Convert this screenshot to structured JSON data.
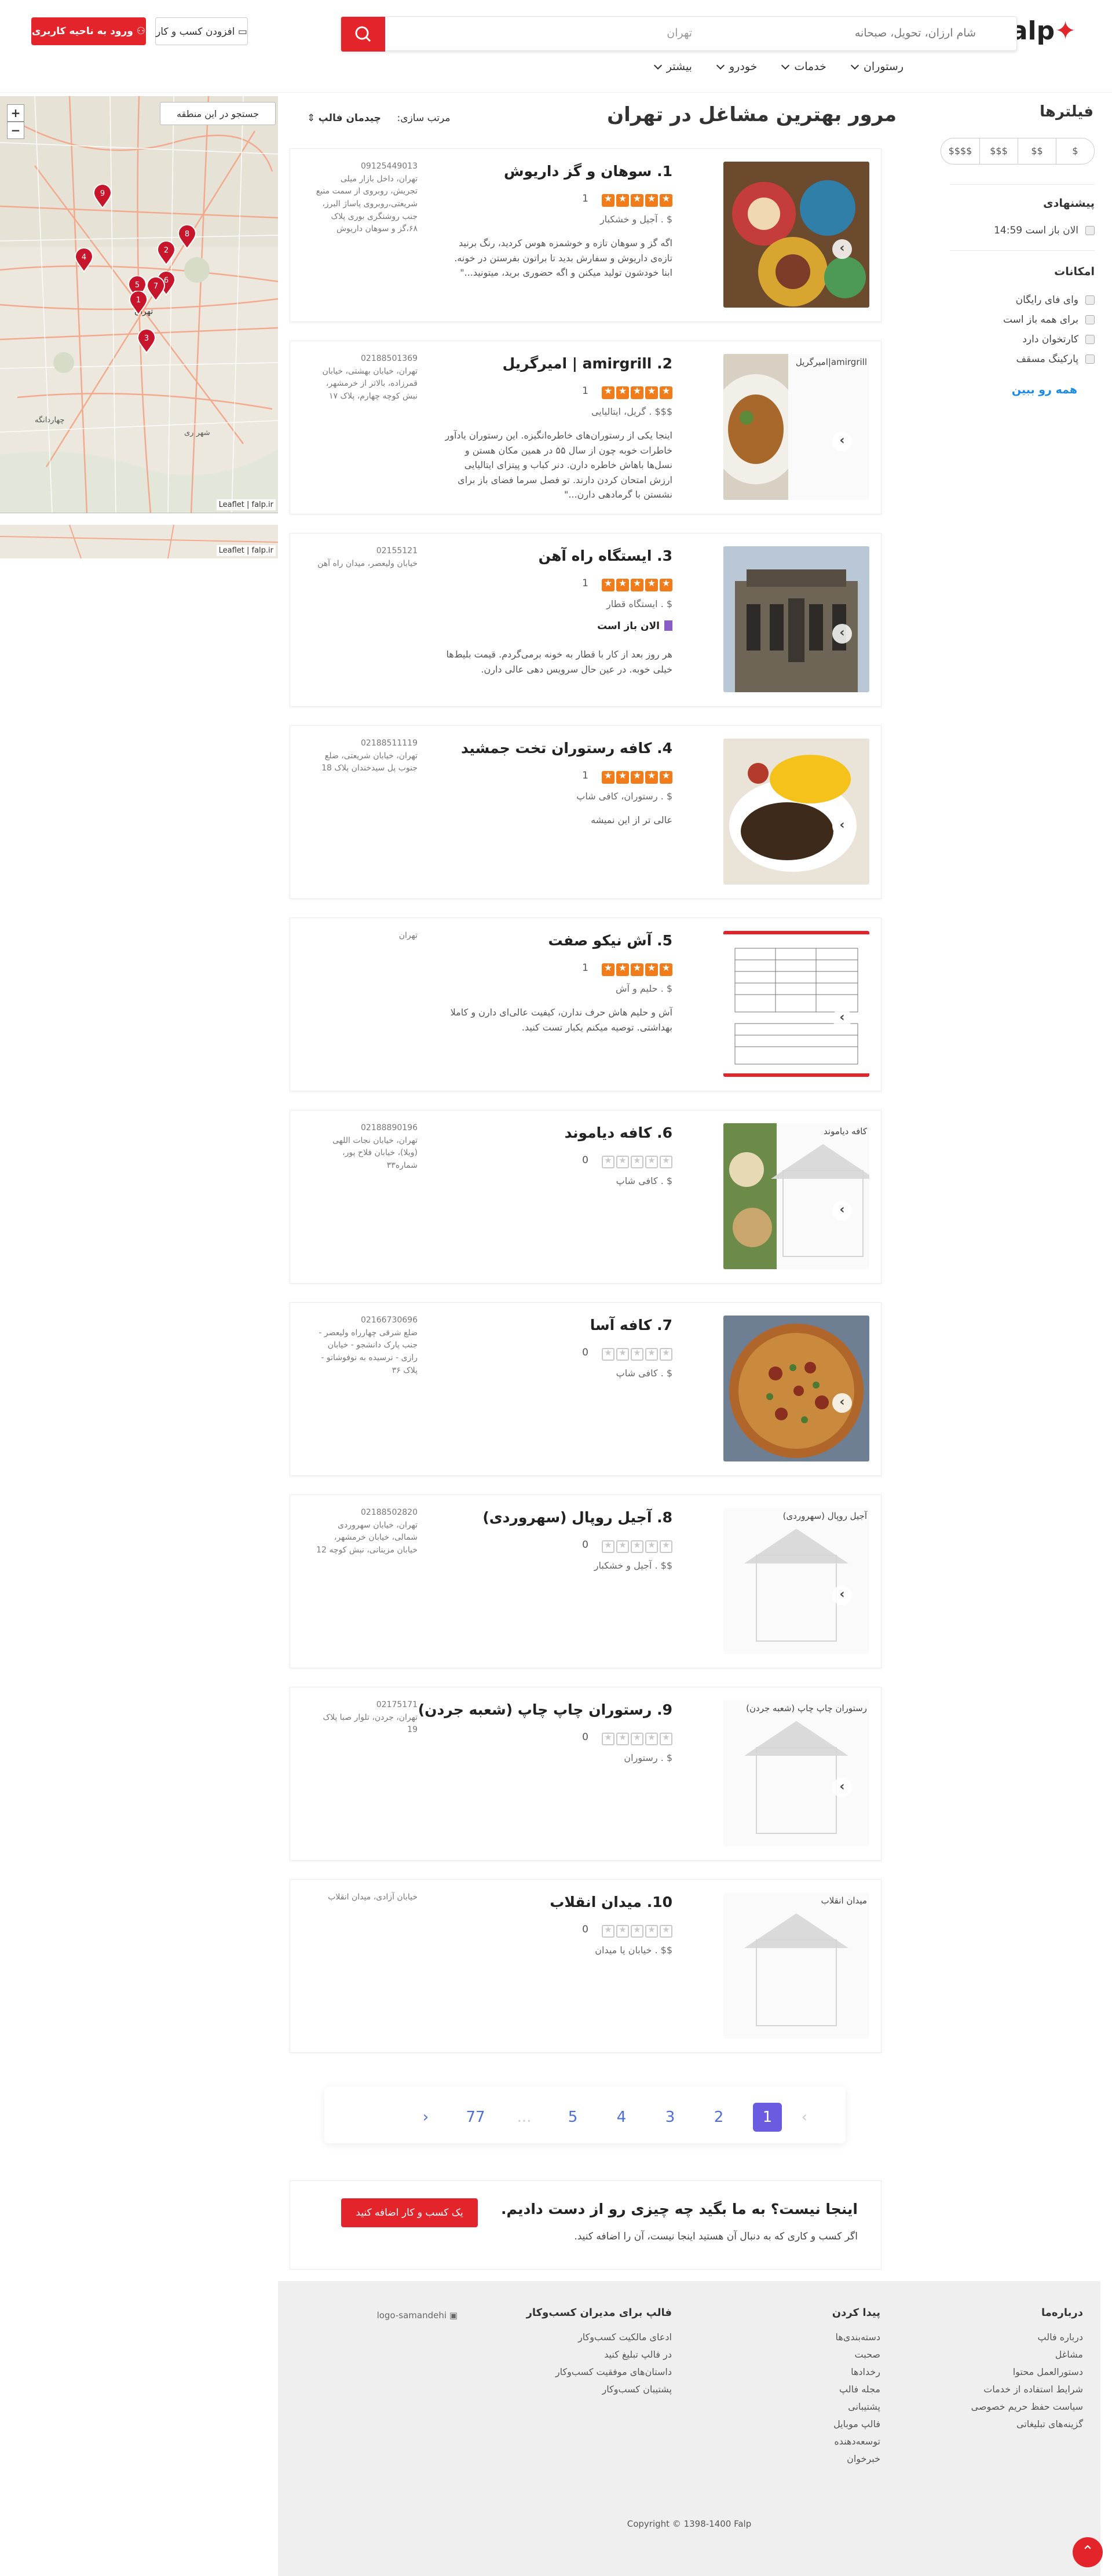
{
  "header": {
    "logo": "falp",
    "search_what": "شام ارزان، تحویل، صبحانه",
    "search_where": "تهران",
    "login_label": "ورود به ناحیه کاربری",
    "add_business_label": "افزودن کسب و کار",
    "nav": [
      "رستوران",
      "خدمات",
      "خودرو",
      "بیشتر"
    ]
  },
  "filters": {
    "title": "فیلترها",
    "prices": [
      "$",
      "$$",
      "$$$",
      "$$$$"
    ],
    "suggested_title": "پیشنهادی",
    "open_now": "الان باز است 14:59",
    "features_title": "امکانات",
    "features": [
      "وای فای رایگان",
      "برای همه باز است",
      "کارتخوان دارد",
      "پارکینگ مسقف"
    ],
    "see_all": "همه رو ببین"
  },
  "main": {
    "title": "مرور بهترین مشاغل در تهران",
    "sort_label": "مرتب سازی:",
    "sort_value": "چیدمان فالپ"
  },
  "map": {
    "search_area": "جستجو در این منطقه",
    "zoom_in": "+",
    "zoom_out": "−",
    "attribution": "Leaflet | falp.ir",
    "labels": [
      "تهران",
      "شهر ری",
      "چهاردانگه"
    ]
  },
  "listings": [
    {
      "title": "1. سوهان و گز داریوش",
      "stars": 5,
      "reviews": "1",
      "category": "$ . آجیل و خشکبار",
      "open": "",
      "snippet": "اگه گز و سوهان تازه و خوشمزه هوس کردید، رنگ برنید تازه‌ی داریوش و سفارش بدید تا براتون بفرستن در خونه. ابنا خودشون تولید میکنن و اگه حضوری برید، میتونید...\"",
      "phone": "09125449013",
      "address": "تهران، داخل بازار میلی تجریش، روبروی از سمت منبع شریعتی،روبروی پاساژ البرز، جنب روشنگری بوری پلاک ۶۸،گز و سوهان داریوش"
    },
    {
      "title": "2. amirgrill | امیرگریل",
      "stars": 5,
      "reviews": "1",
      "category": "$$$ . گریل، ایتالیایی",
      "open": "",
      "snippet": "اینجا یکی از رستوران‌های خاطره‌انگیزه. این رستوران یادآور خاطرات خوبه چون از سال ۵۵ در همین مکان هستن و نسل‌ها باهاش خاطره دارن. دنر کباب و پیتزای ایتالیایی ارزش امتحان کردن دارند. تو فصل سرما فضای باز برای نشستن با گرمادهی دارن...\"",
      "phone": "02188501369",
      "address": "تهران، خیابان بهشتی، خیابان قمرزاده، بالاتر از خرمشهر، نبش کوچه چهارم، پلاک ۱۷",
      "alt": "amirgrill|امیرگریل"
    },
    {
      "title": "3. ایستگاه راه آهن",
      "stars": 5,
      "reviews": "1",
      "category": "$ . ایستگاه قطار",
      "open": "الان باز است",
      "snippet": "هر روز بعد از کار با قطار به خونه برمی‌گردم. قیمت بلیط‌ها خیلی خوبه. در عین حال سرویس دهی عالی دارن.",
      "phone": "02155121",
      "address": "خیابان ولیعصر، میدان راه آهن"
    },
    {
      "title": "4. کافه رستوران تخت جمشید",
      "stars": 5,
      "reviews": "1",
      "category": "$ . رستوران، کافی شاپ",
      "open": "",
      "snippet": "عالی تر از این نمیشه",
      "phone": "02188511119",
      "address": "تهران، خیابان شریعتی، ضلع جنوب پل سیدخندان پلاک 18"
    },
    {
      "title": "5. آش نیکو صفت",
      "stars": 5,
      "reviews": "1",
      "category": "$ . حلیم و آش",
      "open": "",
      "snippet": "آش و حلیم هاش حرف ندارن، کیفیت عالی‌ای دارن و کاملا بهداشتی. توصیه میکنم یکبار تست کنید.",
      "phone": "",
      "address": "تهران"
    },
    {
      "title": "6. کافه دیاموند",
      "stars": 0,
      "reviews": "0",
      "category": "$ . کافی شاپ",
      "open": "",
      "snippet": "",
      "phone": "02188890196",
      "address": "تهران، خیابان نجات اللهی (ویلا)، خیابان فلاح پور، شماره۳۳",
      "alt": "کافه دیاموند"
    },
    {
      "title": "7. کافه آسا",
      "stars": 0,
      "reviews": "0",
      "category": "$ . کافی شاپ",
      "open": "",
      "snippet": "",
      "phone": "02166730696",
      "address": "ضلع شرقی چهارراه ولیعصر - جنب پارک دانشجو - خیابان رازی - نرسیده به نوفوشاتو - پلاک ۳۶"
    },
    {
      "title": "8. آجیل روپال (سهروردی)",
      "stars": 0,
      "reviews": "0",
      "category": "$$ . آجیل و خشکبار",
      "open": "",
      "snippet": "",
      "phone": "02188502820",
      "address": "تهران، خیابان سهروردی شمالی، خیابان خرمشهر، خیابان مزینانی، نبش کوچه 12",
      "alt": "آجیل روپال (سهروردی)"
    },
    {
      "title": "9. رستوران چاپ چاپ (شعبه جردن)",
      "stars": 0,
      "reviews": "0",
      "category": "$ . رستوران",
      "open": "",
      "snippet": "",
      "phone": "02175171",
      "address": "تهران، جردن، تلوار صبا پلاک 19",
      "alt": "رستوران چاپ چاپ (شعبه جردن)"
    },
    {
      "title": "10. میدان انقلاب",
      "stars": 0,
      "reviews": "0",
      "category": "$$ . خیابان یا میدان",
      "open": "",
      "snippet": "",
      "phone": "",
      "address": "خیابان آزادی، میدان انقلاب",
      "alt": "میدان انقلاب"
    }
  ],
  "pagination": {
    "prev": "›",
    "pages": [
      "1",
      "2",
      "3",
      "4",
      "5"
    ],
    "dots": "...",
    "last": "77",
    "next": "‹"
  },
  "cta": {
    "title": "اینجا نیست؟ به ما بگید چه چیزی رو از دست دادیم.",
    "text": "اگر کسب و کاری که به دنبال آن هستید اینجا نیست، آن را اضافه کنید.",
    "button": "یک کسب و کار اضافه کنید"
  },
  "footer": {
    "about_title": "درباره‌ما",
    "about": [
      "درباره فالپ",
      "مشاغل",
      "دستورالعمل محتوا",
      "شرایط استفاده از خدمات",
      "سیاست حفظ حریم خصوصی",
      "گزینه‌های تبلیغاتی"
    ],
    "discover_title": "پیدا کردن",
    "discover": [
      "دسته‌بندی‌ها",
      "صحبت",
      "رخدادها",
      "مجله فالپ",
      "پشتیبانی",
      "فالپ موبایل",
      "توسعه‌دهنده",
      "خبرخوان"
    ],
    "owners_title": "فالپ برای مدیران کسب‌وکار",
    "owners": [
      "ادعای مالکیت کسب‌وکار",
      "در فالپ تبلیغ کنید",
      "داستان‌های موفقیت کسب‌وکار",
      "پشتیبان کسب‌وکار"
    ],
    "logo_alt": "logo-samandehi",
    "copyright": "Copyright © 1398-1400 Falp"
  },
  "colors": {
    "brand": "#e3242b",
    "star": "#f27b1a",
    "link": "#1a8be7",
    "page_active": "#6a5be0"
  }
}
